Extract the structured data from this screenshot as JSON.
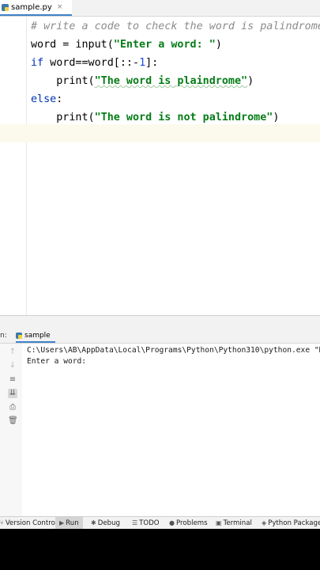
{
  "editor_tab": {
    "filename": "sample.py",
    "close_glyph": "×"
  },
  "code": {
    "line1": "# write a code to check the word is palindrome",
    "line2_var": "word = input(",
    "line2_str": "\"Enter a word: \"",
    "line2_end": ")",
    "line3_kw": "if",
    "line3_a": " word==word[::-",
    "line3_num": "1",
    "line3_b": "]:",
    "line4_fn": "    print(",
    "line4_str": "\"The word is plaindrome\"",
    "line4_end": ")",
    "line5_kw": "else",
    "line5_end": ":",
    "line6_fn": "    print(",
    "line6_str": "\"The word is not palindrome\"",
    "line6_end": ")"
  },
  "run_panel": {
    "label": "n:",
    "tab_label": "sample"
  },
  "console": {
    "line1": "C:\\Users\\AB\\AppData\\Local\\Programs\\Python\\Python310\\python.exe \"D:\\",
    "line2": "Enter a word:"
  },
  "status_bar": {
    "items": [
      {
        "label": "Version Control",
        "icon": "version-control-icon"
      },
      {
        "label": "Run",
        "icon": "run-icon",
        "active": true
      },
      {
        "label": "Debug",
        "icon": "debug-icon"
      },
      {
        "label": "TODO",
        "icon": "todo-icon"
      },
      {
        "label": "Problems",
        "icon": "problems-icon"
      },
      {
        "label": "Terminal",
        "icon": "terminal-icon"
      },
      {
        "label": "Python Packages",
        "icon": "python-packages-icon"
      }
    ]
  },
  "colors": {
    "keyword": "#0033b3",
    "string": "#067d17",
    "comment": "#8c8c8c",
    "number": "#1750eb",
    "accent": "#4083c9"
  }
}
